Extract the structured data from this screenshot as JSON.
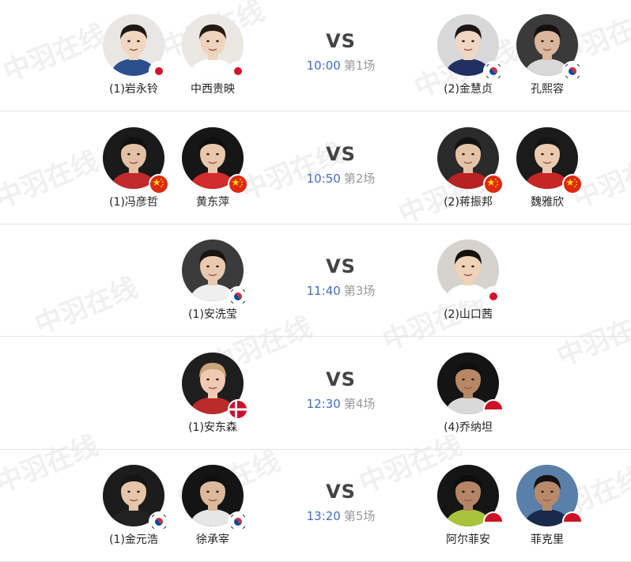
{
  "matches": [
    {
      "vs": "VS",
      "time": "10:00",
      "order": "第1场",
      "left": [
        {
          "name": "(1)岩永铃",
          "flag": "japan",
          "bg": "#e9e6e3",
          "skin": "#f1d7c0",
          "hair": "#1e1812",
          "shirt": "#2c4f8f"
        },
        {
          "name": "中西贵映",
          "flag": "japan",
          "bg": "#ebe8e4",
          "skin": "#eed4bd",
          "hair": "#241a14",
          "shirt": "#ffffff"
        }
      ],
      "right": [
        {
          "name": "(2)金慧贞",
          "flag": "korea",
          "bg": "#d8d8d8",
          "skin": "#efd6c3",
          "hair": "#1c1714",
          "shirt": "#1f2f5f"
        },
        {
          "name": "孔熙容",
          "flag": "korea",
          "bg": "#3a3a3a",
          "skin": "#d9b69c",
          "hair": "#141010",
          "shirt": "#d8d8d8"
        }
      ]
    },
    {
      "vs": "VS",
      "time": "10:50",
      "order": "第2场",
      "left": [
        {
          "name": "(1)冯彦哲",
          "flag": "china",
          "bg": "#1a1a1a",
          "skin": "#e2c1a4",
          "hair": "#111111",
          "shirt": "#c02a2a"
        },
        {
          "name": "黄东萍",
          "flag": "china",
          "bg": "#161616",
          "skin": "#e8c7aa",
          "hair": "#0f0f0f",
          "shirt": "#d22b2b"
        }
      ],
      "right": [
        {
          "name": "(2)蒋振邦",
          "flag": "china",
          "bg": "#2a2a2a",
          "skin": "#e3c3a6",
          "hair": "#121212",
          "shirt": "#b82222"
        },
        {
          "name": "魏雅欣",
          "flag": "china",
          "bg": "#1b1b1b",
          "skin": "#eacbb0",
          "hair": "#151515",
          "shirt": "#c62626"
        }
      ]
    },
    {
      "vs": "VS",
      "time": "11:40",
      "order": "第3场",
      "left": [
        {
          "name": "(1)安洗莹",
          "flag": "korea",
          "bg": "#3b3b3b",
          "skin": "#e9cab0",
          "hair": "#1a1410",
          "shirt": "#efefef"
        }
      ],
      "right": [
        {
          "name": "(2)山口茜",
          "flag": "japan",
          "bg": "#d6d2cc",
          "skin": "#f0d2b8",
          "hair": "#16110e",
          "shirt": "#ffffff"
        }
      ]
    },
    {
      "vs": "VS",
      "time": "12:30",
      "order": "第4场",
      "left": [
        {
          "name": "(1)安东森",
          "flag": "denmark",
          "bg": "#1e1e1e",
          "skin": "#f0c9b3",
          "hair": "#caa57a",
          "shirt": "#bb2b2b"
        }
      ],
      "right": [
        {
          "name": "(4)乔纳坦",
          "flag": "indonesia",
          "bg": "#141414",
          "skin": "#b88765",
          "hair": "#0e0e0e",
          "shirt": "#d9d9d9"
        }
      ]
    },
    {
      "vs": "VS",
      "time": "13:20",
      "order": "第5场",
      "left": [
        {
          "name": "(1)金元浩",
          "flag": "korea",
          "bg": "#1c1c1c",
          "skin": "#e6c6aa",
          "hair": "#151515",
          "shirt": "#222222"
        },
        {
          "name": "徐承宰",
          "flag": "korea",
          "bg": "#141414",
          "skin": "#dcb99b",
          "hair": "#101010",
          "shirt": "#e6e6e6"
        }
      ],
      "right": [
        {
          "name": "阿尔菲安",
          "flag": "indonesia",
          "bg": "#151515",
          "skin": "#b48566",
          "hair": "#0d0d0d",
          "shirt": "#a9c43a"
        },
        {
          "name": "菲克里",
          "flag": "indonesia",
          "bg": "#5a7fa8",
          "skin": "#b98a69",
          "hair": "#121212",
          "shirt": "#1a2a4a"
        }
      ]
    }
  ],
  "watermark": "中羽在线",
  "colors": {
    "time": "#3d6fbf",
    "order": "#999999",
    "vs": "#444444",
    "name": "#222222",
    "divider": "#e3e3e3"
  }
}
